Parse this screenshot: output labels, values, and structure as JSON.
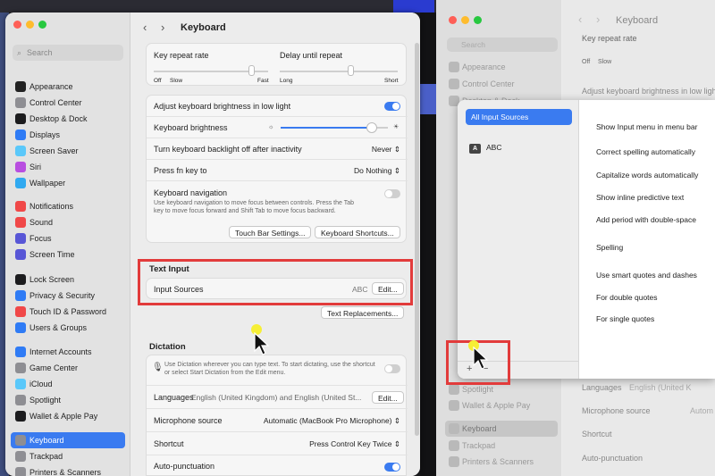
{
  "window": {
    "title": "Keyboard"
  },
  "search": {
    "placeholder": "Search"
  },
  "sidebar": {
    "items": [
      {
        "label": "Appearance",
        "icon": "appearance-icon",
        "color": "#222222"
      },
      {
        "label": "Control Center",
        "icon": "control-center-icon",
        "color": "#8e8e93"
      },
      {
        "label": "Desktop & Dock",
        "icon": "desktop-dock-icon",
        "color": "#1c1c1e"
      },
      {
        "label": "Displays",
        "icon": "displays-icon",
        "color": "#2f7bf5"
      },
      {
        "label": "Screen Saver",
        "icon": "screen-saver-icon",
        "color": "#5ac8fa"
      },
      {
        "label": "Siri",
        "icon": "siri-icon",
        "color": "#b84ee0"
      },
      {
        "label": "Wallpaper",
        "icon": "wallpaper-icon",
        "color": "#30a9f0"
      },
      {
        "label": "Notifications",
        "icon": "notifications-icon",
        "color": "#f04848"
      },
      {
        "label": "Sound",
        "icon": "sound-icon",
        "color": "#f04848"
      },
      {
        "label": "Focus",
        "icon": "focus-icon",
        "color": "#5856d6"
      },
      {
        "label": "Screen Time",
        "icon": "screen-time-icon",
        "color": "#5856d6"
      },
      {
        "label": "Lock Screen",
        "icon": "lock-screen-icon",
        "color": "#1c1c1e"
      },
      {
        "label": "Privacy & Security",
        "icon": "privacy-icon",
        "color": "#2f7bf5"
      },
      {
        "label": "Touch ID & Password",
        "icon": "touch-id-icon",
        "color": "#f04848"
      },
      {
        "label": "Users & Groups",
        "icon": "users-groups-icon",
        "color": "#2f7bf5"
      },
      {
        "label": "Internet Accounts",
        "icon": "internet-accounts-icon",
        "color": "#2f7bf5"
      },
      {
        "label": "Game Center",
        "icon": "game-center-icon",
        "color": "#8e8e93"
      },
      {
        "label": "iCloud",
        "icon": "icloud-icon",
        "color": "#5ac8fa"
      },
      {
        "label": "Spotlight",
        "icon": "spotlight-icon",
        "color": "#8e8e93"
      },
      {
        "label": "Wallet & Apple Pay",
        "icon": "wallet-icon",
        "color": "#1c1c1e"
      },
      {
        "label": "Keyboard",
        "icon": "keyboard-icon",
        "color": "#8e8e93"
      },
      {
        "label": "Trackpad",
        "icon": "trackpad-icon",
        "color": "#8e8e93"
      },
      {
        "label": "Printers & Scanners",
        "icon": "printers-icon",
        "color": "#8e8e93"
      }
    ]
  },
  "keyboard": {
    "key_repeat_rate": "Key repeat rate",
    "delay_until_repeat": "Delay until repeat",
    "off": "Off",
    "slow": "Slow",
    "fast": "Fast",
    "long": "Long",
    "short": "Short",
    "adjust_brightness": "Adjust keyboard brightness in low light",
    "keyboard_brightness": "Keyboard brightness",
    "backlight_off": "Turn keyboard backlight off after inactivity",
    "backlight_value": "Never",
    "press_fn": "Press fn key to",
    "press_fn_value": "Do Nothing",
    "keyboard_navigation": "Keyboard navigation",
    "keyboard_navigation_desc": "Use keyboard navigation to move focus between controls. Press the Tab key to move focus forward and Shift Tab to move focus backward.",
    "touch_bar_settings": "Touch Bar Settings...",
    "keyboard_shortcuts": "Keyboard Shortcuts...",
    "text_input": "Text Input",
    "input_sources": "Input Sources",
    "input_sources_value": "ABC",
    "edit": "Edit...",
    "text_replacements": "Text Replacements...",
    "dictation": "Dictation",
    "dictation_desc": "Use Dictation wherever you can type text. To start dictating, use the shortcut or select Start Dictation from the Edit menu.",
    "languages": "Languages",
    "languages_value": "English (United Kingdom) and English (United St...",
    "microphone_source": "Microphone source",
    "microphone_value": "Automatic (MacBook Pro Microphone)",
    "shortcut": "Shortcut",
    "shortcut_value": "Press Control Key Twice",
    "auto_punctuation": "Auto-punctuation"
  },
  "background_window": {
    "title": "Keyboard",
    "key_repeat_rate": "Key repeat rate",
    "off": "Off",
    "slow": "Slow",
    "adjust_brightness": "Adjust keyboard brightness in low light",
    "languages": "Languages",
    "languages_value": "English (United K",
    "microphone_source": "Microphone source",
    "microphone_value": "Autom",
    "shortcut": "Shortcut",
    "auto_punctuation": "Auto-punctuation",
    "search": "Search",
    "sidebar": [
      "Appearance",
      "Control Center",
      "Desktop & Dock",
      "Spotlight",
      "Wallet & Apple Pay",
      "Keyboard",
      "Trackpad",
      "Printers & Scanners"
    ]
  },
  "input_sources_sheet": {
    "all_input_sources": "All Input Sources",
    "abc_badge": "A",
    "abc_label": "ABC",
    "add": "+",
    "remove": "−",
    "options": [
      "Show Input menu in menu bar",
      "Correct spelling automatically",
      "Capitalize words automatically",
      "Show inline predictive text",
      "Add period with double-space",
      "Spelling",
      "Use smart quotes and dashes",
      "For double quotes",
      "For single quotes"
    ]
  },
  "values": {
    "keyboard_brightness_level": 0.85,
    "key_repeat_rate_level": 0.85,
    "delay_until_repeat_level": 0.6
  }
}
